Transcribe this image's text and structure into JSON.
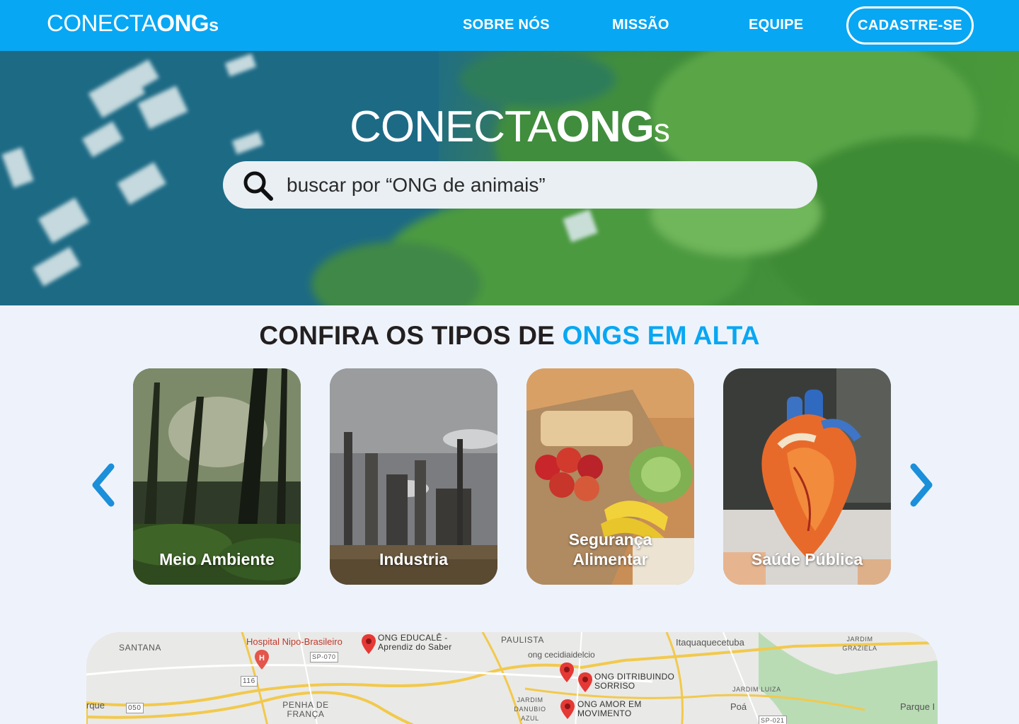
{
  "brand": {
    "logo_part1": "CONECTA",
    "logo_part2": "ONG",
    "logo_part3": "s"
  },
  "nav": {
    "links": [
      "SOBRE NÓS",
      "MISSÃO",
      "EQUIPE"
    ],
    "cta": "CADASTRE-SE",
    "background": "#08a7f3"
  },
  "hero": {
    "title_part1": "CONECTA",
    "title_part2": "ONG",
    "title_part3": "s",
    "search_placeholder": "buscar por “ONG de animais”",
    "search_icon": "search-icon"
  },
  "section": {
    "title_dark": "CONFIRA OS TIPOS DE ",
    "title_accent": "ONGS EM ALTA",
    "accent_color": "#08a7f3"
  },
  "carousel": {
    "prev_icon": "chevron-left-icon",
    "next_icon": "chevron-right-icon",
    "cards": [
      {
        "label": "Meio Ambiente",
        "image": "forest-image"
      },
      {
        "label": "Industria",
        "image": "factory-image"
      },
      {
        "label": "Segurança\nAlimentar",
        "image": "groceries-image"
      },
      {
        "label": "Saúde Pública",
        "image": "heart-model-image"
      }
    ]
  },
  "map": {
    "places": [
      "SANTANA",
      "Hospital Nipo-Brasileiro",
      "PAULISTA",
      "Itaquaquecetuba",
      "JARDIM GRAZIELA",
      "rque",
      "PENHA DE FRANÇA",
      "JARDIM DANUBIO AZUL",
      "JARDIM LUIZA",
      "Poá",
      "Parque I",
      "ong cecidiaidelcio"
    ],
    "road_shields": [
      "SP-070",
      "116",
      "050",
      "SP-021"
    ],
    "ongs": [
      "ONG EDUCALÊ -\nAprendiz do Saber",
      "ONG DITRIBUINDO\nSORRISO",
      "ONG AMOR EM\nMOVIMENTO"
    ]
  }
}
